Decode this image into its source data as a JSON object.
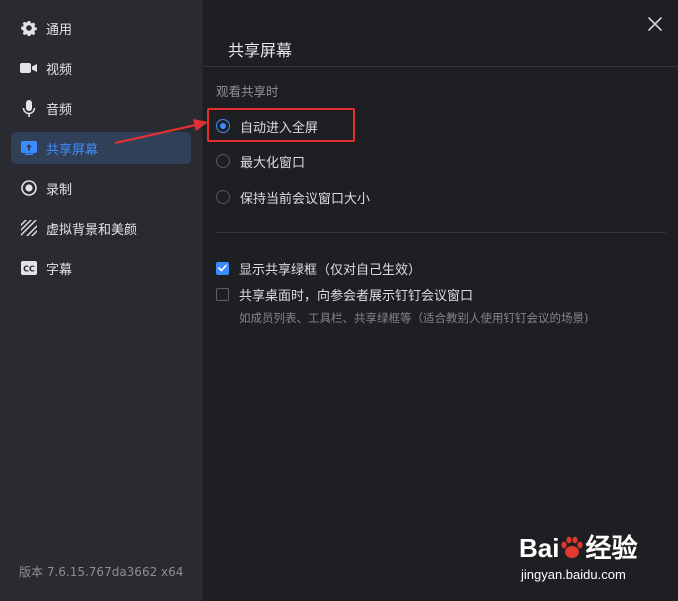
{
  "sidebar": {
    "items": [
      {
        "label": "通用",
        "icon": "gear-icon"
      },
      {
        "label": "视频",
        "icon": "video-camera-icon"
      },
      {
        "label": "音频",
        "icon": "microphone-icon"
      },
      {
        "label": "共享屏幕",
        "icon": "share-screen-icon",
        "active": true
      },
      {
        "label": "录制",
        "icon": "record-icon"
      },
      {
        "label": "虚拟背景和美颜",
        "icon": "virtual-background-icon"
      },
      {
        "label": "字幕",
        "icon": "caption-icon"
      }
    ],
    "version": "版本 7.6.15.767da3662 x64"
  },
  "main": {
    "title": "共享屏幕",
    "section_label": "观看共享时",
    "radio_options": [
      {
        "label": "自动进入全屏",
        "checked": true
      },
      {
        "label": "最大化窗口",
        "checked": false
      },
      {
        "label": "保持当前会议窗口大小",
        "checked": false
      }
    ],
    "checkboxes": [
      {
        "label": "显示共享绿框（仅对自己生效）",
        "checked": true
      },
      {
        "label": "共享桌面时，向参会者展示钉钉会议窗口",
        "checked": false
      }
    ],
    "hint": "如成员列表、工具栏、共享绿框等（适合教别人使用钉钉会议的场景)"
  },
  "watermark": {
    "brand_prefix": "Bai",
    "brand_suffix": "经验",
    "url": "jingyan.baidu.com"
  },
  "colors": {
    "accent": "#3d8cff",
    "annotation": "#e03030",
    "sidebar_bg": "#2a2b30",
    "main_bg": "#1e1f23"
  }
}
